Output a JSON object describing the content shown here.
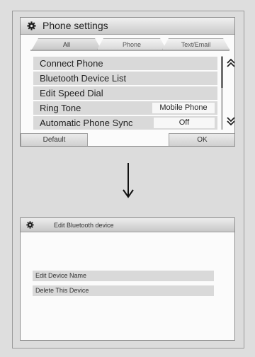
{
  "screen1": {
    "title": "Phone settings",
    "tabs": [
      {
        "label": "All",
        "active": true
      },
      {
        "label": "Phone",
        "active": false
      },
      {
        "label": "Text/Email",
        "active": false
      }
    ],
    "rows": [
      {
        "label": "Connect Phone",
        "value": ""
      },
      {
        "label": "Bluetooth Device List",
        "value": ""
      },
      {
        "label": "Edit Speed Dial",
        "value": ""
      },
      {
        "label": "Ring Tone",
        "value": "Mobile Phone"
      },
      {
        "label": "Automatic Phone Sync",
        "value": "Off"
      }
    ],
    "buttons": {
      "default": "Default",
      "ok": "OK"
    }
  },
  "screen2": {
    "title": "Edit Bluetooth device",
    "options": [
      "Edit Device Name",
      "Delete This Device"
    ]
  },
  "icons": {
    "settings": "gear-icon",
    "scroll_up": "chevron-double-up-icon",
    "scroll_down": "chevron-double-down-icon",
    "flow": "arrow-down-icon"
  }
}
